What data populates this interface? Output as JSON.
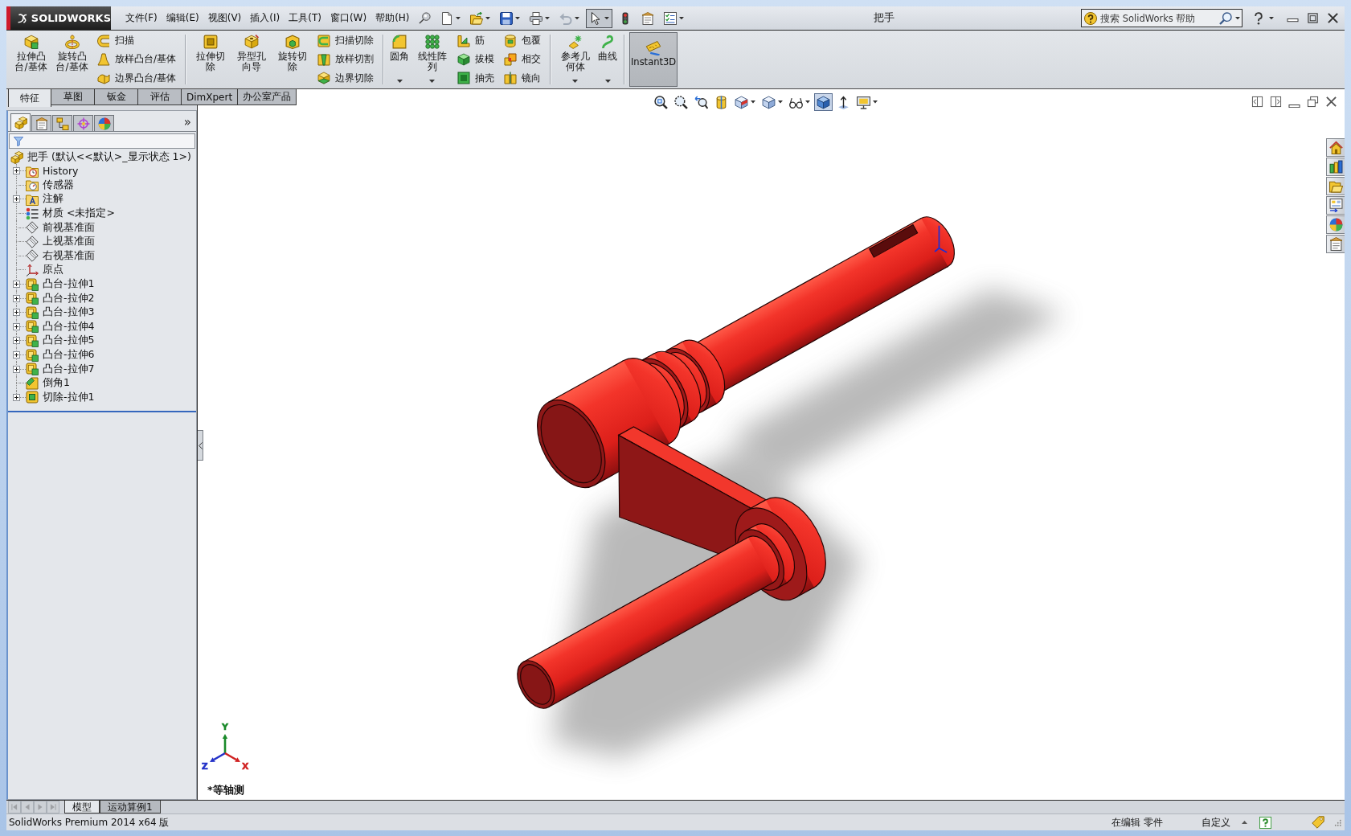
{
  "title_bar": {
    "logo": "SOLIDWORKS",
    "menu": [
      "文件(F)",
      "编辑(E)",
      "视图(V)",
      "插入(I)",
      "工具(T)",
      "窗口(W)",
      "帮助(H)"
    ],
    "quick_access": [
      {
        "kind": "new",
        "dropdown": true,
        "disabled": false,
        "pressed": false
      },
      {
        "kind": "open",
        "dropdown": true,
        "disabled": false,
        "pressed": false
      },
      {
        "kind": "save",
        "dropdown": true,
        "disabled": false,
        "pressed": false
      },
      {
        "kind": "print",
        "dropdown": true,
        "disabled": false,
        "pressed": false
      },
      {
        "kind": "undo",
        "dropdown": true,
        "disabled": true,
        "pressed": false
      },
      {
        "kind": "select",
        "dropdown": true,
        "disabled": false,
        "pressed": true
      },
      {
        "kind": "rebuild",
        "dropdown": false,
        "disabled": false,
        "pressed": false
      },
      {
        "kind": "file-properties",
        "dropdown": false,
        "disabled": false,
        "pressed": false
      },
      {
        "kind": "options",
        "dropdown": true,
        "disabled": false,
        "pressed": false
      }
    ],
    "title": "把手",
    "search": {
      "placeholder": "搜索 SolidWorks 帮助"
    }
  },
  "command_manager": {
    "groups": [
      {
        "large": [
          {
            "label": "拉伸凸台/基体",
            "kind": "extruded-boss",
            "dropdown": false,
            "pressed": false
          },
          {
            "label": "旋转凸台/基体",
            "kind": "revolved-boss",
            "dropdown": false,
            "pressed": false
          }
        ],
        "small": [
          [
            {
              "label": "扫描",
              "kind": "swept-boss"
            },
            {
              "label": "放样凸台/基体",
              "kind": "lofted-boss"
            },
            {
              "label": "边界凸台/基体",
              "kind": "boundary-boss"
            }
          ]
        ]
      },
      {
        "large": [
          {
            "label": "拉伸切除",
            "kind": "extruded-cut",
            "dropdown": false,
            "pressed": false
          },
          {
            "label": "异型孔向导",
            "kind": "hole-wizard",
            "dropdown": false,
            "pressed": false
          },
          {
            "label": "旋转切除",
            "kind": "revolved-cut",
            "dropdown": false,
            "pressed": false
          }
        ],
        "small": [
          [
            {
              "label": "扫描切除",
              "kind": "swept-cut"
            },
            {
              "label": "放样切割",
              "kind": "lofted-cut"
            },
            {
              "label": "边界切除",
              "kind": "boundary-cut"
            }
          ]
        ]
      },
      {
        "large": [
          {
            "label": "圆角",
            "kind": "fillet",
            "dropdown": true,
            "pressed": false
          },
          {
            "label": "线性阵列",
            "kind": "linear-pattern",
            "dropdown": true,
            "pressed": false
          }
        ],
        "small": [
          [
            {
              "label": "筋",
              "kind": "rib"
            },
            {
              "label": "拔模",
              "kind": "draft"
            },
            {
              "label": "抽壳",
              "kind": "shell"
            }
          ],
          [
            {
              "label": "包覆",
              "kind": "wrap"
            },
            {
              "label": "相交",
              "kind": "intersect"
            },
            {
              "label": "镜向",
              "kind": "mirror"
            }
          ]
        ]
      },
      {
        "large": [
          {
            "label": "参考几何体",
            "kind": "reference-geometry",
            "dropdown": true,
            "pressed": false
          },
          {
            "label": "曲线",
            "kind": "curves",
            "dropdown": true,
            "pressed": false
          }
        ]
      },
      {
        "large": [
          {
            "label": "Instant3D",
            "kind": "instant3d",
            "dropdown": false,
            "pressed": true
          }
        ]
      }
    ],
    "tabs": [
      {
        "label": "特征",
        "selected": true
      },
      {
        "label": "草图",
        "selected": false
      },
      {
        "label": "钣金",
        "selected": false
      },
      {
        "label": "评估",
        "selected": false
      },
      {
        "label": "DimXpert",
        "selected": false
      },
      {
        "label": "办公室产品",
        "selected": false
      }
    ]
  },
  "feature_manager": {
    "tabs": [
      {
        "kind": "feature-tree",
        "selected": true
      },
      {
        "kind": "property",
        "selected": false
      },
      {
        "kind": "configuration",
        "selected": false
      },
      {
        "kind": "dimxpert",
        "selected": false
      },
      {
        "kind": "display",
        "selected": false
      }
    ],
    "expand_button": "»",
    "tree": {
      "label": "把手 (默认<<默认>_显示状态 1>)",
      "kind": "part",
      "children": [
        {
          "label": "History",
          "kind": "history",
          "expandable": true
        },
        {
          "label": "传感器",
          "kind": "sensors",
          "expandable": false
        },
        {
          "label": "注解",
          "kind": "annotations",
          "expandable": true
        },
        {
          "label": "材质 <未指定>",
          "kind": "material",
          "expandable": false
        },
        {
          "label": "前视基准面",
          "kind": "plane",
          "expandable": false
        },
        {
          "label": "上视基准面",
          "kind": "plane",
          "expandable": false
        },
        {
          "label": "右视基准面",
          "kind": "plane",
          "expandable": false
        },
        {
          "label": "原点",
          "kind": "origin",
          "expandable": false
        },
        {
          "label": "凸台-拉伸1",
          "kind": "extrude",
          "expandable": true
        },
        {
          "label": "凸台-拉伸2",
          "kind": "extrude",
          "expandable": true
        },
        {
          "label": "凸台-拉伸3",
          "kind": "extrude",
          "expandable": true
        },
        {
          "label": "凸台-拉伸4",
          "kind": "extrude",
          "expandable": true
        },
        {
          "label": "凸台-拉伸5",
          "kind": "extrude",
          "expandable": true
        },
        {
          "label": "凸台-拉伸6",
          "kind": "extrude",
          "expandable": true
        },
        {
          "label": "凸台-拉伸7",
          "kind": "extrude",
          "expandable": true
        },
        {
          "label": "倒角1",
          "kind": "chamfer",
          "expandable": false
        },
        {
          "label": "切除-拉伸1",
          "kind": "cut",
          "expandable": true
        }
      ]
    }
  },
  "viewport": {
    "heads_up": [
      {
        "kind": "zoom-fit",
        "dropdown": false,
        "pressed": false
      },
      {
        "kind": "zoom-area",
        "dropdown": false,
        "pressed": false
      },
      {
        "kind": "previous-view",
        "dropdown": false,
        "pressed": false
      },
      {
        "kind": "section-view",
        "dropdown": false,
        "pressed": false
      },
      {
        "kind": "view-orientation",
        "dropdown": true,
        "pressed": false
      },
      {
        "kind": "display-style",
        "dropdown": true,
        "pressed": false
      },
      {
        "kind": "hide-show",
        "dropdown": true,
        "pressed": false
      },
      {
        "kind": "appearance",
        "dropdown": false,
        "pressed": true
      },
      {
        "kind": "scene",
        "dropdown": false,
        "pressed": false
      },
      {
        "kind": "view-settings",
        "dropdown": true,
        "pressed": false
      }
    ],
    "window_controls": [
      {
        "kind": "tile-left"
      },
      {
        "kind": "tile-right"
      },
      {
        "kind": "minimize"
      },
      {
        "kind": "restore"
      },
      {
        "kind": "close"
      }
    ],
    "task_pane": [
      {
        "kind": "home"
      },
      {
        "kind": "design-library"
      },
      {
        "kind": "file-explorer"
      },
      {
        "kind": "view-palette"
      },
      {
        "kind": "appearances"
      },
      {
        "kind": "custom-properties"
      }
    ],
    "triad": [
      {
        "label": "Y",
        "color": "#1a8a2a"
      },
      {
        "label": "Z",
        "color": "#2230c8"
      },
      {
        "label": "X",
        "color": "#d02020"
      }
    ],
    "view_name": "*等轴测"
  },
  "bottom_bar": {
    "nav": [
      {
        "kind": "first",
        "disabled": true
      },
      {
        "kind": "previous",
        "disabled": true
      },
      {
        "kind": "next",
        "disabled": true
      },
      {
        "kind": "last",
        "disabled": true
      }
    ],
    "tabs": [
      {
        "label": "模型",
        "selected": true
      },
      {
        "label": "运动算例1",
        "selected": false
      }
    ]
  },
  "status_bar": {
    "product": "SolidWorks Premium 2014 x64 版",
    "mode": "在编辑 零件",
    "units": "自定义"
  }
}
